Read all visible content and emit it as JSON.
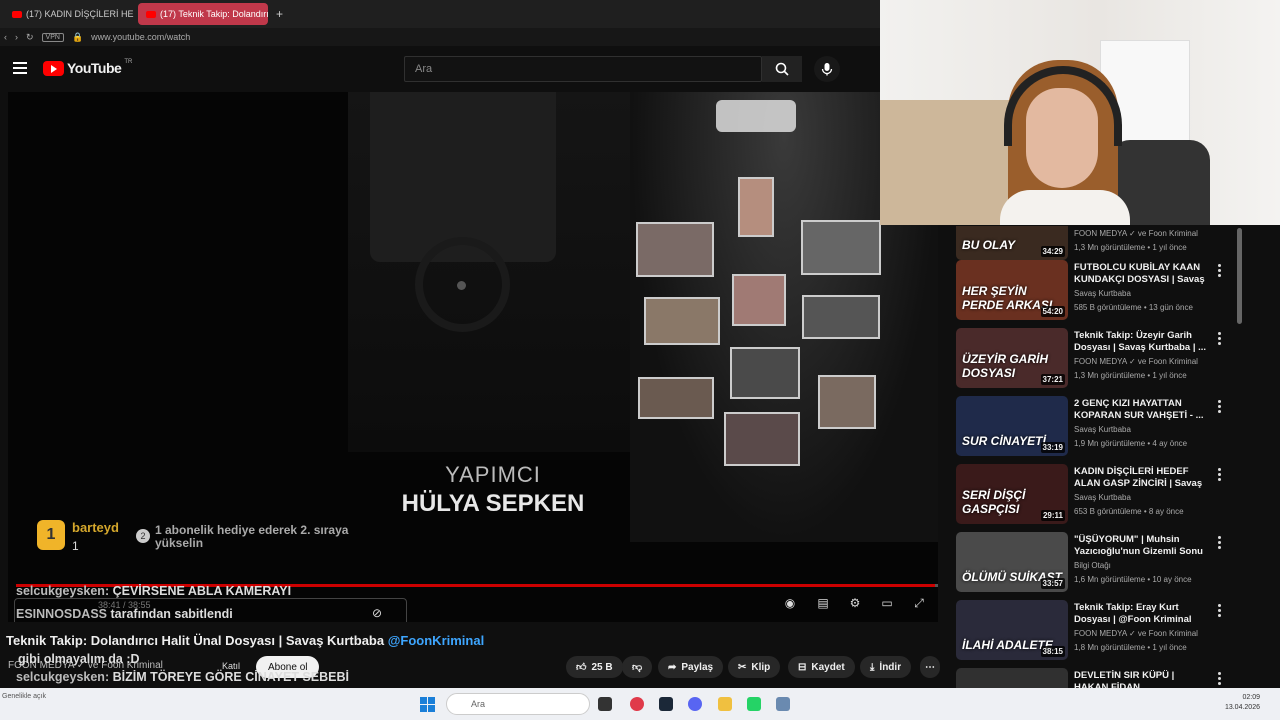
{
  "tabs": [
    {
      "label": "(17) KADIN DİŞÇİLERİ HEDEF"
    },
    {
      "label": "(17) Teknik Takip: Dolandırıcı"
    }
  ],
  "tab_add": "+",
  "address": {
    "vpn": "VPN",
    "url": "www.youtube.com/watch"
  },
  "header": {
    "logo_text": "YouTube",
    "region": "TR",
    "search_placeholder": "Ara"
  },
  "video": {
    "credit_role": "YAPIMCI",
    "credit_name": "HÜLYA SEPKEN",
    "progress": 0.997,
    "time": "38:41 / 38:55"
  },
  "gift": {
    "rank": "1",
    "user": "barteyd",
    "count": "1",
    "num": "2",
    "text": "1 abonelik hediye ederek 2. sıraya yükselin"
  },
  "chat": [
    {
      "user": "selcukgeysken:",
      "text": "ÇEVİRSENE ABLA KAMERAYI"
    },
    {
      "user": "ESINNOSDASS",
      "text": "tarafından sabitlendi"
    },
    {
      "user": "selcukgeysken:",
      "text": "BİZİM TÖREYE GÖRE CİNAYET SEBEBİ"
    }
  ],
  "video_title": "Teknik Takip: Dolandırıcı Halit Ünal Dosyası | Savaş Kurtbaba",
  "title_mention": "@FoonKriminal",
  "chat_overlay": "gibi olmayalım da :D",
  "channel": "FOON MEDYA ✓ ve Foon Kriminal",
  "join_label": "Katıl",
  "subscribe_label": "Abone ol",
  "actions": {
    "like": "25 B",
    "share": "Paylaş",
    "clip": "Klip",
    "save": "Kaydet",
    "download": "İndir"
  },
  "recommendations": [
    {
      "thumb_label": "BU OLAY",
      "duration": "34:29",
      "title": "",
      "channel": "FOON MEDYA ✓ ve Foon Kriminal",
      "meta": "1,3 Mn görüntüleme • 1 yıl önce",
      "color": "#3a2a20"
    },
    {
      "thumb_label": "HER ŞEYİN PERDE ARKASI",
      "duration": "54:20",
      "title": "FUTBOLCU KUBİLAY KAAN KUNDAKÇI DOSYASI | Savaş ...",
      "channel": "Savaş Kurtbaba",
      "meta": "585 B görüntüleme • 13 gün önce",
      "color": "#6a3020"
    },
    {
      "thumb_label": "ÜZEYİR GARİH DOSYASI",
      "duration": "37:21",
      "title": "Teknik Takip: Üzeyir Garih Dosyası | Savaş Kurtbaba | ...",
      "channel": "FOON MEDYA ✓ ve Foon Kriminal",
      "meta": "1,3 Mn görüntüleme • 1 yıl önce",
      "color": "#4a2a2a"
    },
    {
      "thumb_label": "SUR CİNAYETİ",
      "duration": "33:19",
      "title": "2 GENÇ KIZI HAYATTAN KOPARAN SUR VAHŞETİ - ...",
      "channel": "Savaş Kurtbaba",
      "meta": "1,9 Mn görüntüleme • 4 ay önce",
      "color": "#1f2a4a"
    },
    {
      "thumb_label": "SERİ DİŞÇİ GASPÇISI",
      "duration": "29:11",
      "title": "KADIN DİŞÇİLERİ HEDEF ALAN GASP ZİNCİRİ | Savaş Kurtbab...",
      "channel": "Savaş Kurtbaba",
      "meta": "653 B görüntüleme • 8 ay önce",
      "color": "#3a1a1a"
    },
    {
      "thumb_label": "ÖLÜMÜ SUİKAST",
      "duration": "33:57",
      "title": "\"ÜŞÜYORUM\" | Muhsin Yazıcıoğlu'nun Gizemli Sonu",
      "channel": "Bilgi Otağı",
      "meta": "1,6 Mn görüntüleme • 10 ay önce",
      "color": "#4a4a4a"
    },
    {
      "thumb_label": "İLAHİ ADALETE",
      "duration": "38:15",
      "title": "Teknik Takip: Eray Kurt Dosyası | @Foon Kriminal",
      "channel": "FOON MEDYA ✓ ve Foon Kriminal",
      "meta": "1,8 Mn görüntüleme • 1 yıl önce",
      "color": "#2a2a3a"
    },
    {
      "thumb_label": "",
      "duration": "",
      "title": "DEVLETİN SIR KÜPÜ | HAKAN FİDAN",
      "channel": "",
      "meta": "",
      "color": "#303030"
    }
  ],
  "taskbar": {
    "left_text": "Genelikle açık",
    "search": "Ara",
    "time": "02:09",
    "date": "13.04.2026"
  }
}
